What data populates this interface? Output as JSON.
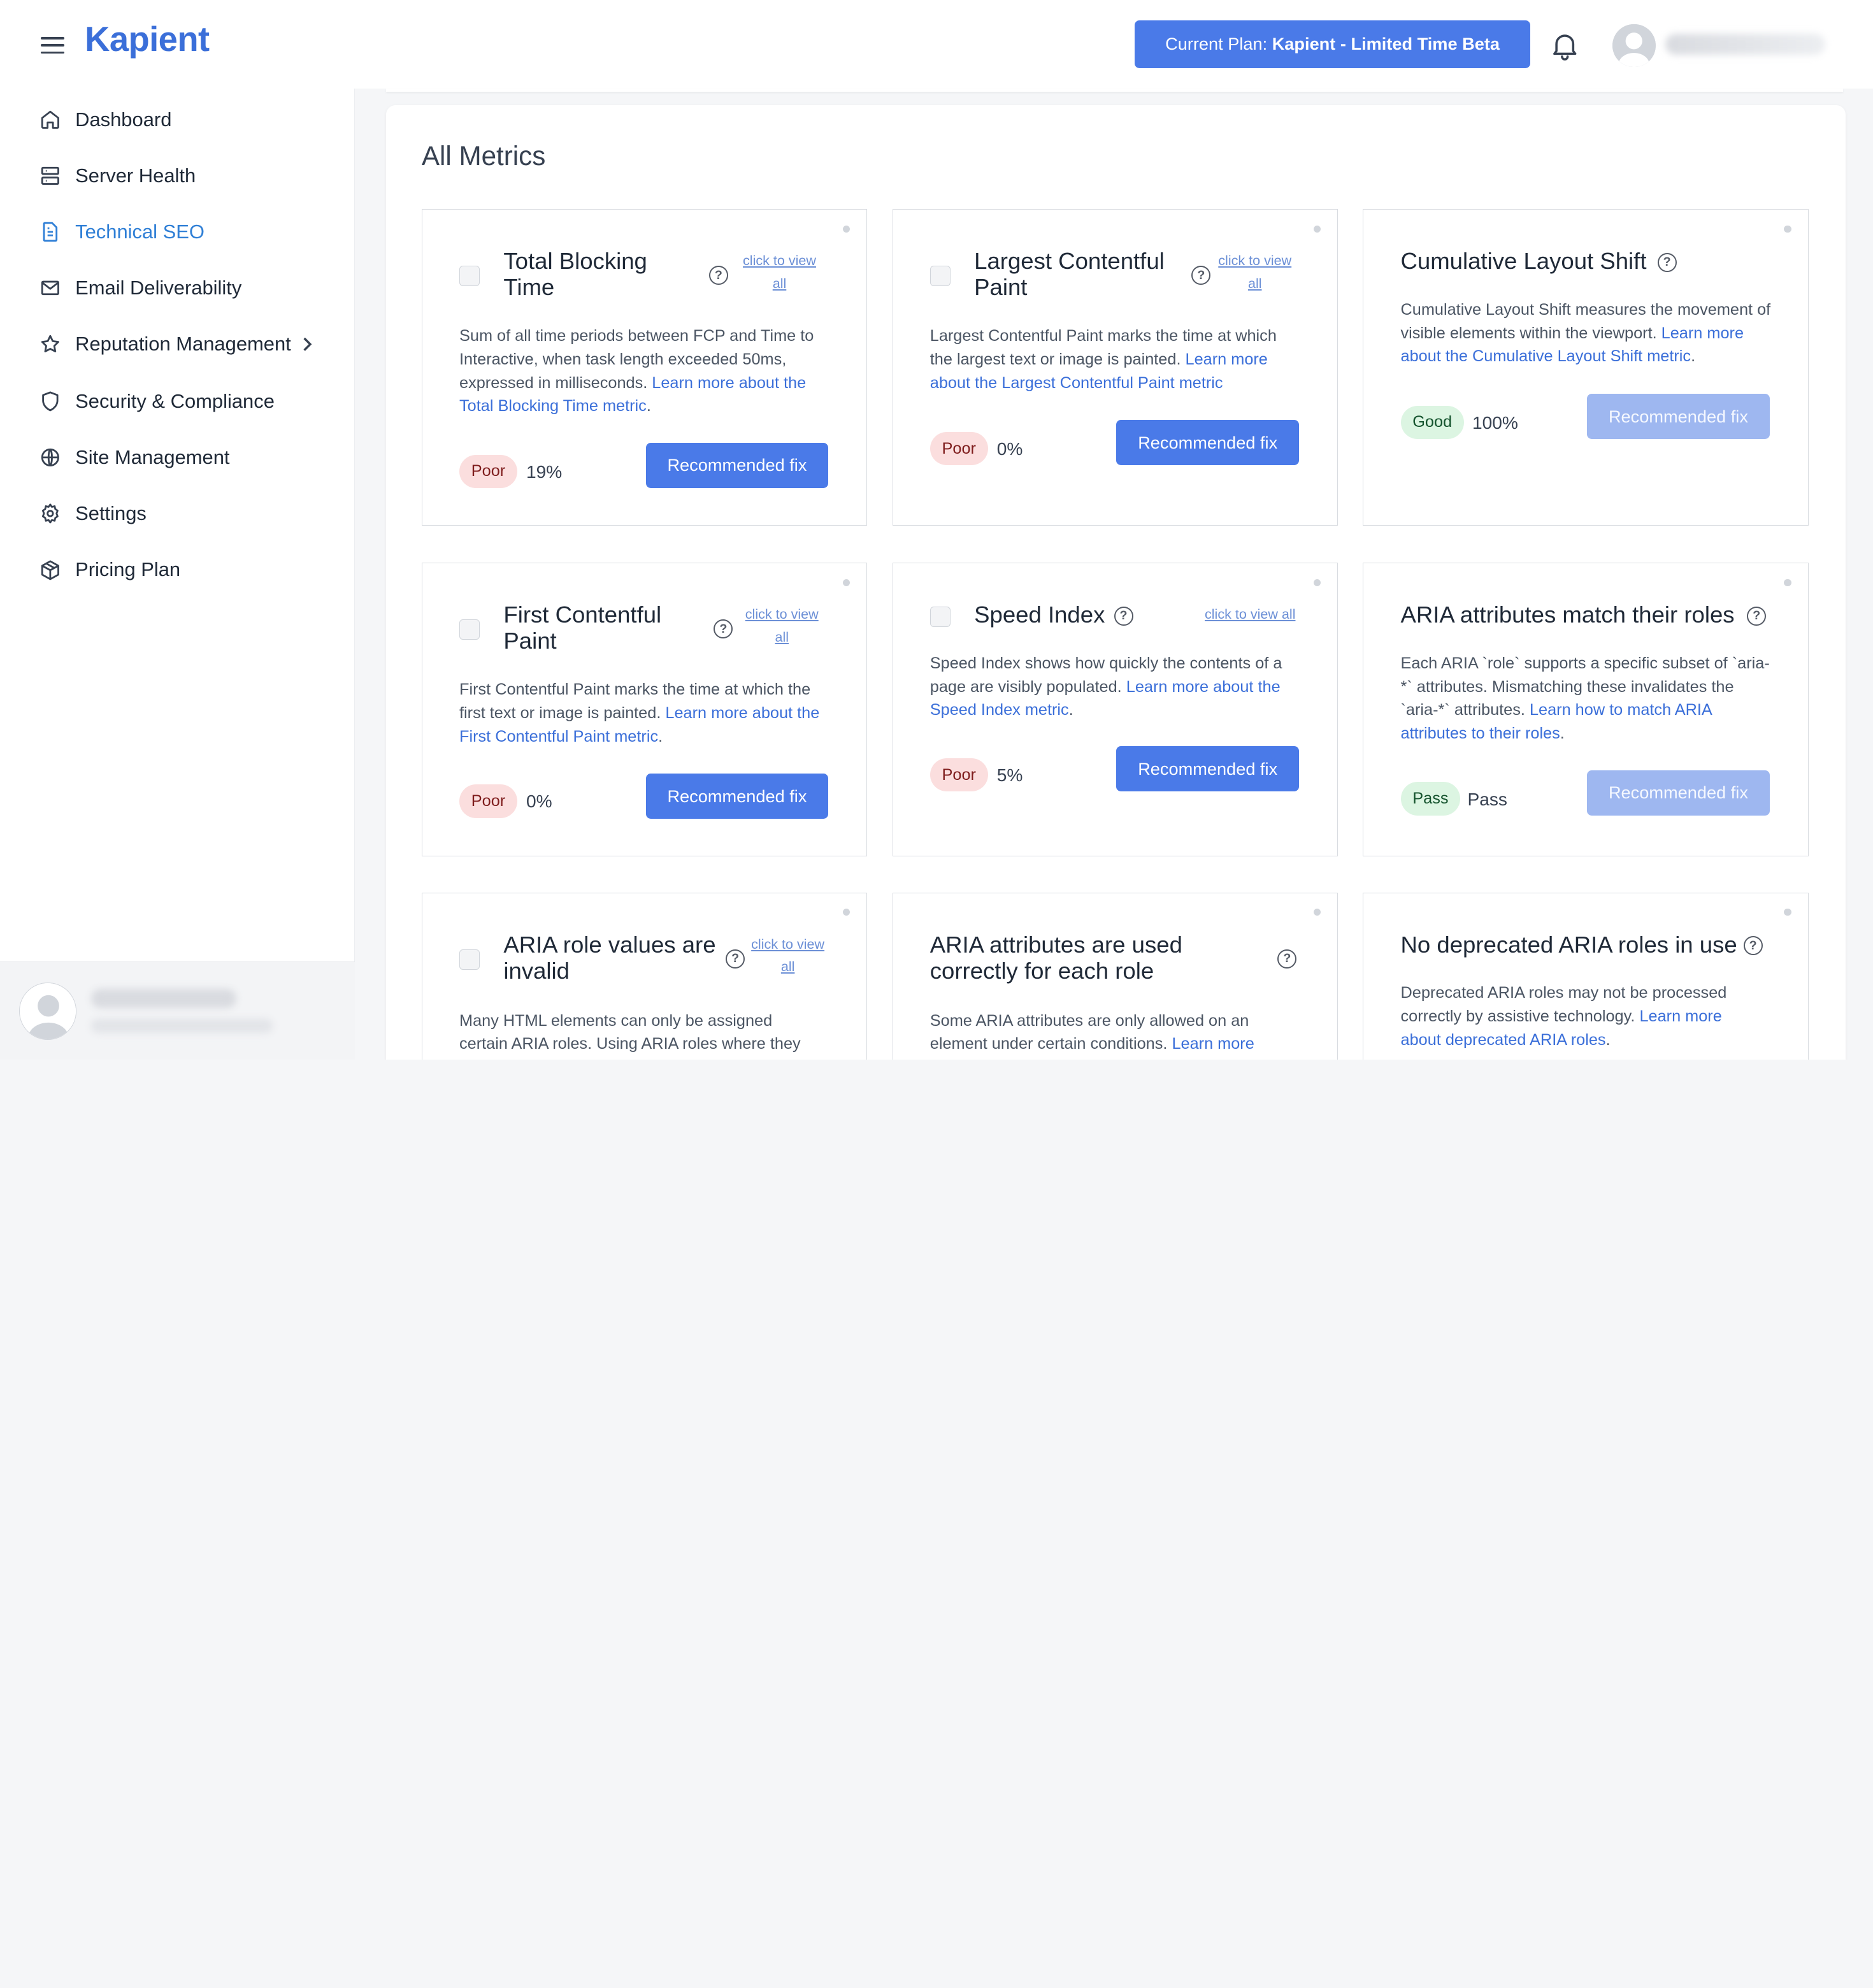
{
  "header": {
    "logo": "Kapient",
    "plan_label": "Current Plan:",
    "plan_name": "Kapient - Limited Time Beta"
  },
  "sidebar": {
    "items": [
      {
        "label": "Dashboard",
        "icon": "home-icon"
      },
      {
        "label": "Server Health",
        "icon": "server-icon"
      },
      {
        "label": "Technical SEO",
        "icon": "document-icon",
        "active": true
      },
      {
        "label": "Email Deliverability",
        "icon": "mail-icon"
      },
      {
        "label": "Reputation Management",
        "icon": "star-icon",
        "has_submenu": true
      },
      {
        "label": "Security & Compliance",
        "icon": "shield-icon"
      },
      {
        "label": "Site Management",
        "icon": "globe-icon"
      },
      {
        "label": "Settings",
        "icon": "gear-icon"
      },
      {
        "label": "Pricing Plan",
        "icon": "package-icon"
      }
    ]
  },
  "main": {
    "title": "All Metrics",
    "view_all_label": "click to view all",
    "help_glyph": "?",
    "fix_label": "Recommended fix",
    "cards": [
      {
        "title": "Total Blocking Time",
        "desc": "Sum of all time periods between FCP and Time to Interactive, when task length exceeded 50ms, expressed in milliseconds.",
        "link": "Learn more about the Total Blocking Time metric",
        "status": "Poor",
        "value": "19%"
      },
      {
        "title": "Largest Contentful Paint",
        "desc": "Largest Contentful Paint marks the time at which the largest text or image is painted.",
        "link": "Learn more about the Largest Contentful Paint metric",
        "status": "Poor",
        "value": "0%"
      },
      {
        "title": "Cumulative Layout Shift",
        "desc": "Cumulative Layout Shift measures the movement of visible elements within the viewport.",
        "link": "Learn more about the Cumulative Layout Shift metric",
        "status": "Good",
        "value": "100%"
      },
      {
        "title": "First Contentful Paint",
        "desc": "First Contentful Paint marks the time at which the first text or image is painted.",
        "link": "Learn more about the First Contentful Paint metric",
        "status": "Poor",
        "value": "0%"
      },
      {
        "title": "Speed Index",
        "desc": "Speed Index shows how quickly the contents of a page are visibly populated.",
        "link": "Learn more about the Speed Index metric",
        "status": "Poor",
        "value": "5%"
      },
      {
        "title": "ARIA attributes match their roles",
        "desc": "Each ARIA `role` supports a specific subset of `aria-*` attributes. Mismatching these invalidates the `aria-*` attributes.",
        "link": "Learn how to match ARIA attributes to their roles",
        "status": "Pass",
        "value": "Pass"
      },
      {
        "title": "ARIA role values are invalid",
        "desc": "Many HTML elements can only be assigned certain ARIA roles. Using ARIA roles where they",
        "link": ""
      },
      {
        "title": "ARIA attributes are used correctly for each role",
        "desc": "Some ARIA attributes are only allowed on an element under certain conditions.",
        "link": "Learn more"
      },
      {
        "title": "No deprecated ARIA roles in use",
        "desc": "Deprecated ARIA roles may not be processed correctly by assistive technology.",
        "link": "Learn more about deprecated ARIA roles"
      }
    ]
  }
}
